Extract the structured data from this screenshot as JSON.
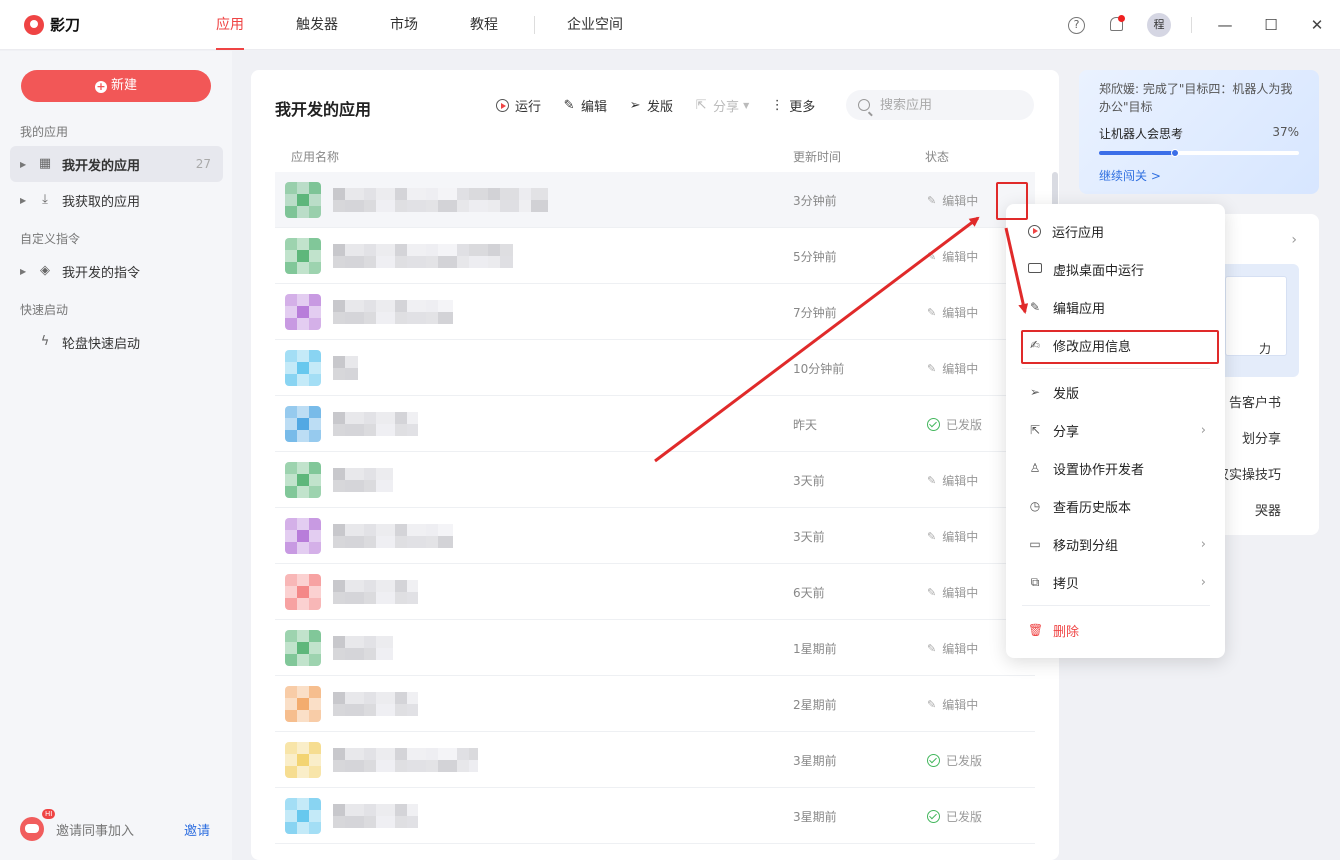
{
  "app": {
    "name": "影刀"
  },
  "nav": {
    "items": [
      "应用",
      "触发器",
      "市场",
      "教程",
      "企业空间"
    ],
    "active": 0
  },
  "titlebar": {
    "help": "?",
    "avatar": "程",
    "minimize": "—",
    "maximize": "☐",
    "close": "✕"
  },
  "sidebar": {
    "new_label": "新建",
    "sections": [
      {
        "title": "我的应用",
        "items": [
          {
            "label": "我开发的应用",
            "count": "27",
            "icon": "grid-icon",
            "active": true
          },
          {
            "label": "我获取的应用",
            "count": "",
            "icon": "download-icon",
            "active": false
          }
        ]
      },
      {
        "title": "自定义指令",
        "items": [
          {
            "label": "我开发的指令",
            "count": "",
            "icon": "layers-icon",
            "active": false
          }
        ]
      },
      {
        "title": "快速启动",
        "items": [
          {
            "label": "轮盘快速启动",
            "count": "",
            "icon": "bolt-icon",
            "active": false
          }
        ]
      }
    ],
    "invite": {
      "badge": "HI",
      "text": "邀请同事加入",
      "link": "邀请"
    }
  },
  "main": {
    "title": "我开发的应用",
    "toolbar": {
      "run": "运行",
      "edit": "编辑",
      "publish": "发版",
      "share": "分享",
      "more": "更多"
    },
    "search_placeholder": "搜索应用",
    "columns": {
      "name": "应用名称",
      "updated": "更新时间",
      "status": "状态"
    },
    "rows": [
      {
        "time": "3分钟前",
        "status": "编辑中",
        "published": false,
        "color": "#4caf6d"
      },
      {
        "time": "5分钟前",
        "status": "编辑中",
        "published": false,
        "color": "#4caf6d"
      },
      {
        "time": "7分钟前",
        "status": "编辑中",
        "published": false,
        "color": "#b06fd6"
      },
      {
        "time": "10分钟前",
        "status": "编辑中",
        "published": false,
        "color": "#57c2ec"
      },
      {
        "time": "昨天",
        "status": "已发版",
        "published": true,
        "color": "#3f9ee0"
      },
      {
        "time": "3天前",
        "status": "编辑中",
        "published": false,
        "color": "#4caf6d"
      },
      {
        "time": "3天前",
        "status": "编辑中",
        "published": false,
        "color": "#b06fd6"
      },
      {
        "time": "6天前",
        "status": "编辑中",
        "published": false,
        "color": "#f37b7b"
      },
      {
        "time": "1星期前",
        "status": "编辑中",
        "published": false,
        "color": "#4caf6d"
      },
      {
        "time": "2星期前",
        "status": "编辑中",
        "published": false,
        "color": "#f2a35e"
      },
      {
        "time": "3星期前",
        "status": "已发版",
        "published": true,
        "color": "#f2cf63"
      },
      {
        "time": "3星期前",
        "status": "已发版",
        "published": true,
        "color": "#57c2ec"
      }
    ]
  },
  "promo": {
    "text": "郑欣媛: 完成了\"目标四：机器人为我办公\"目标",
    "goal": "让机器人会思考",
    "percent": "37%",
    "progress": 0.37,
    "link": "继续闯关 >"
  },
  "right_card": {
    "illus_text": "力",
    "items": [
      "告客户书",
      "划分享",
      "汉实操技巧",
      "哭器"
    ]
  },
  "context_menu": {
    "items": [
      {
        "label": "运行应用",
        "icon": "play-icon",
        "submenu": false
      },
      {
        "label": "虚拟桌面中运行",
        "icon": "monitor-icon",
        "submenu": false
      },
      {
        "label": "编辑应用",
        "icon": "pencil-icon",
        "submenu": false
      },
      {
        "label": "修改应用信息",
        "icon": "edit-info-icon",
        "submenu": false
      },
      {
        "label": "发版",
        "icon": "send-icon",
        "submenu": false
      },
      {
        "label": "分享",
        "icon": "share-icon",
        "submenu": true
      },
      {
        "label": "设置协作开发者",
        "icon": "user-icon",
        "submenu": false
      },
      {
        "label": "查看历史版本",
        "icon": "clock-icon",
        "submenu": false
      },
      {
        "label": "移动到分组",
        "icon": "folder-icon",
        "submenu": true
      },
      {
        "label": "拷贝",
        "icon": "copy-icon",
        "submenu": true
      },
      {
        "label": "删除",
        "icon": "trash-icon",
        "submenu": false
      }
    ]
  },
  "colors": {
    "accent": "#ef4444",
    "link": "#2f6fe0",
    "annotation": "#e02a2a",
    "published": "#43b75d"
  }
}
